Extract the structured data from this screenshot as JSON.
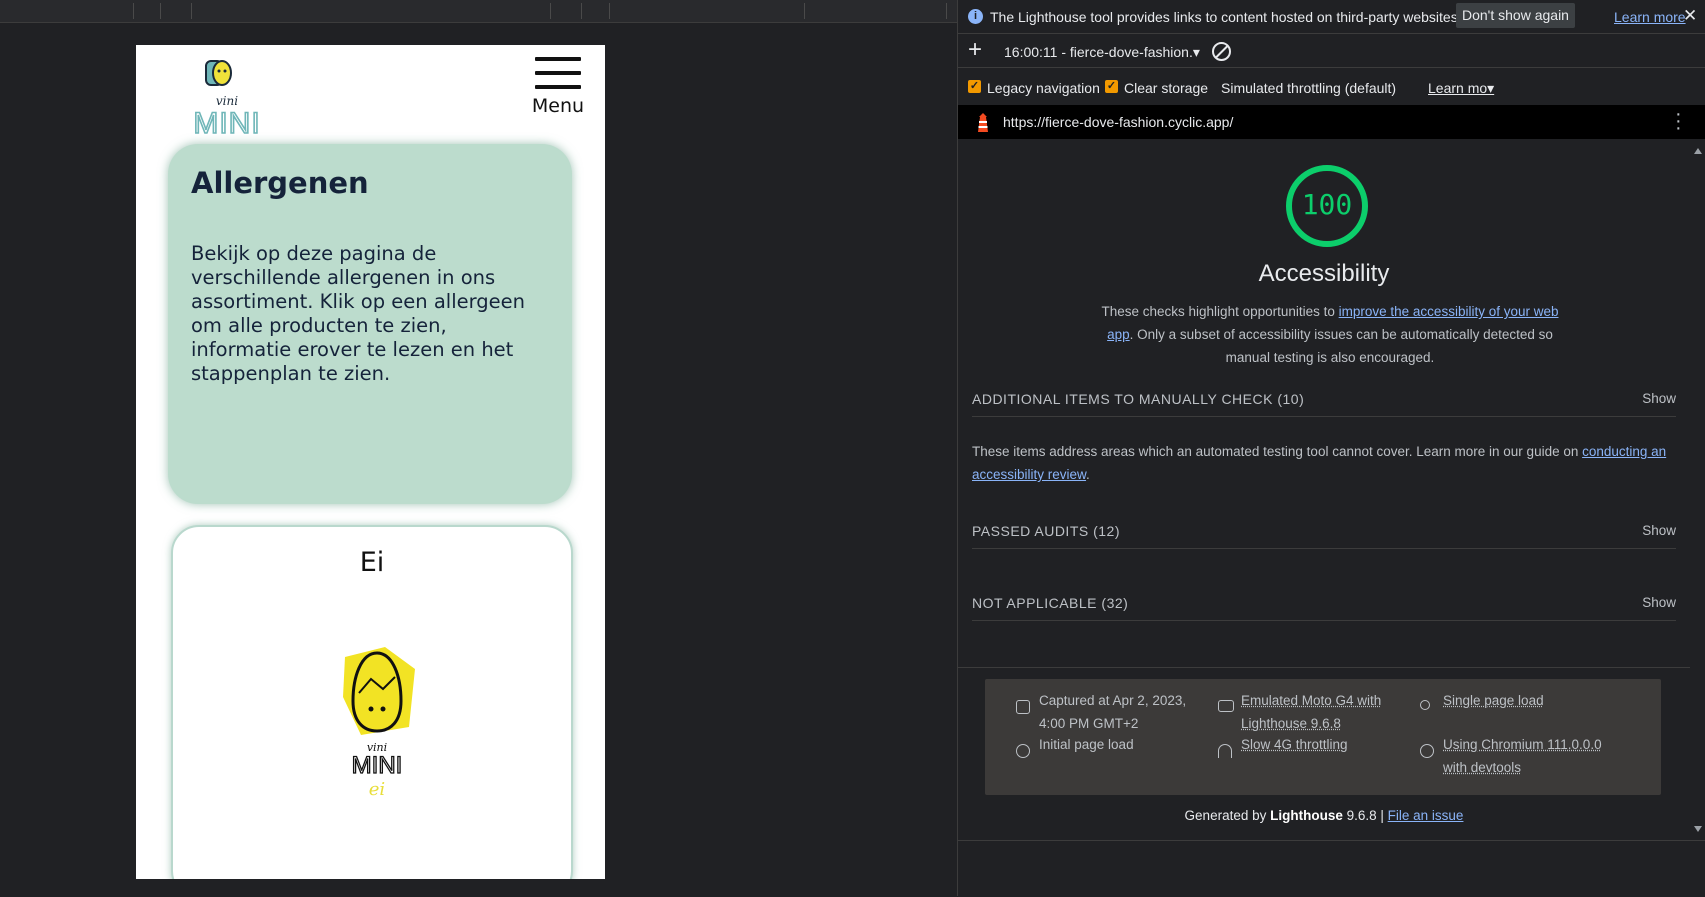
{
  "site": {
    "logo_top_text": "vini",
    "logo_brand": "MINI",
    "menu_label": "Menu",
    "allergens_title": "Allergenen",
    "allergens_text": "Bekijk op deze pagina de verschillende allergenen in ons assortiment. Klik op een allergeen om alle producten te zien, informatie erover te lezen en het stappenplan te zien.",
    "card_title": "Ei",
    "card_logo_top": "vini",
    "card_logo_brand": "MINI",
    "card_logo_sub": "ei"
  },
  "devtools": {
    "infobar": {
      "message": "The Lighthouse tool provides links to content hosted on third-party websites.",
      "dont_show": "Don't show again",
      "learn_more": "Learn more",
      "close": "✕"
    },
    "report_select": "16:00:11 - fierce-dove-fashion.▾",
    "settings": {
      "legacy_navigation": "Legacy navigation",
      "clear_storage": "Clear storage",
      "throttling": "Simulated throttling (default)",
      "learn_more": "Learn mo▾"
    },
    "url": "https://fierce-dove-fashion.cyclic.app/",
    "report": {
      "score": "100",
      "score_value": 100,
      "score_color": "#0cce6b",
      "category": "Accessibility",
      "desc_before": "These checks highlight opportunities to ",
      "desc_link": "improve the accessibility of your web app",
      "desc_after": ". Only a subset of accessibility issues can be automatically detected so manual testing is also encouraged.",
      "groups": [
        {
          "title": "ADDITIONAL ITEMS TO MANUALLY CHECK (10)",
          "action": "Show"
        },
        {
          "title": "PASSED AUDITS (12)",
          "action": "Show"
        },
        {
          "title": "NOT APPLICABLE (32)",
          "action": "Show"
        }
      ],
      "manual_desc_before": "These items address areas which an automated testing tool cannot cover. Learn more in our guide on ",
      "manual_desc_link": "conducting an accessibility review",
      "manual_desc_after": "."
    },
    "footer": {
      "captured_line1": "Captured at Apr 2, 2023,",
      "captured_line2": "4:00 PM GMT+2",
      "initial_load": "Initial page load",
      "emulated_line1": "Emulated Moto G4 with",
      "emulated_line2": "Lighthouse 9.6.8",
      "throttling": "Slow 4G throttling",
      "single_load": "Single page load",
      "chromium_line1": "Using Chromium 111.0.0.0",
      "chromium_line2": "with devtools",
      "generated_by": "Generated by ",
      "lighthouse": "Lighthouse",
      "version": " 9.6.8 | ",
      "file_issue": "File an issue"
    }
  }
}
